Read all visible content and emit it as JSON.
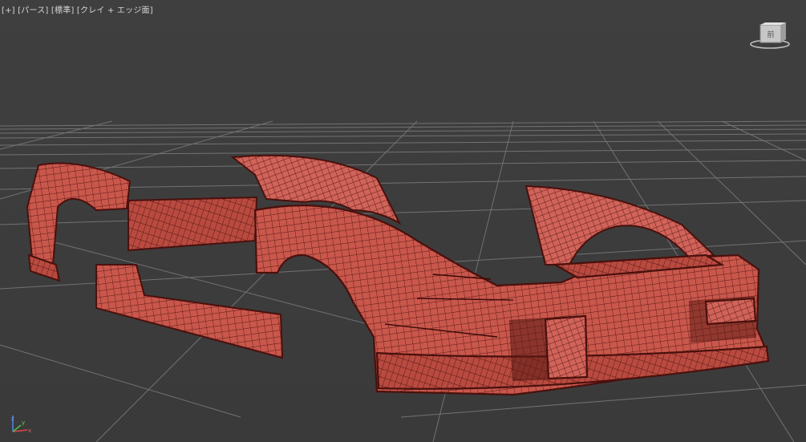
{
  "viewport": {
    "label_menu": "[+]",
    "label_view": "[パース]",
    "label_shading_preset": "[標準]",
    "label_shading_mode": "[クレイ + エッジ面]"
  },
  "viewcube": {
    "face_label": "前",
    "icon": "viewcube-icon"
  },
  "axis_gizmo": {
    "x": "x",
    "y": "y",
    "z": "z"
  },
  "colors": {
    "background": "#3d3d3d",
    "grid": "#7a7a7a",
    "clay": "#c8544a",
    "wire": "#5a1612"
  }
}
